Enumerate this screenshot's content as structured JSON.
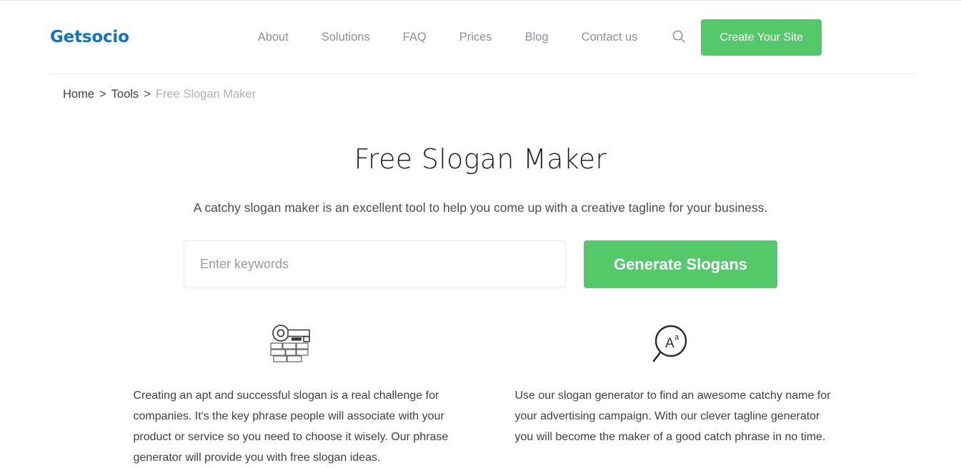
{
  "header": {
    "logo": "Getsocio",
    "nav_items": [
      {
        "label": "About"
      },
      {
        "label": "Solutions"
      },
      {
        "label": "FAQ"
      },
      {
        "label": "Prices"
      },
      {
        "label": "Blog"
      },
      {
        "label": "Contact us"
      }
    ],
    "search_icon": "search-icon",
    "cta_label": "Create Your Site",
    "cta_color": "#53c96a",
    "logo_color": "#0f72c4"
  },
  "breadcrumb": {
    "items": [
      {
        "label": "Home",
        "current": false
      },
      {
        "label": "Tools",
        "current": false
      },
      {
        "label": "Free Slogan Maker",
        "current": true
      }
    ],
    "separator": ">"
  },
  "hero": {
    "title": "Free Slogan Maker",
    "subtitle": "A catchy slogan maker is an excellent tool to help you come up with a creative tagline for your business."
  },
  "form": {
    "input_placeholder": "Enter keywords",
    "input_value": "",
    "button_label": "Generate Slogans",
    "button_color": "#53c96a"
  },
  "features": [
    {
      "icon": "key-brick-wall-icon",
      "text": "Creating an apt and successful slogan is a real challenge for companies. It's the key phrase people will associate with your product or service so you need to choose it wisely. Our phrase generator will provide you with free slogan ideas."
    },
    {
      "icon": "magnifier-letter-a-icon",
      "text": "Use our slogan generator to find an awesome catchy name for your advertising campaign. With our clever tagline generator you will become the maker of a good catch phrase in no time."
    }
  ]
}
